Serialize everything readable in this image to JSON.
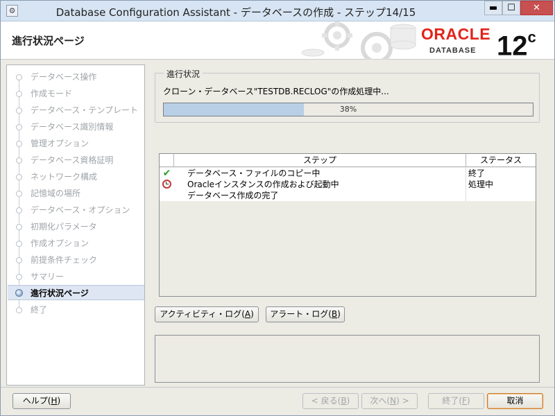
{
  "window": {
    "title": "Database Configuration Assistant - データベースの作成 - ステップ14/15",
    "minimize": "▬",
    "maximize": "☐",
    "close": "✕"
  },
  "header": {
    "page_title": "進行状況ページ",
    "brand": "ORACLE",
    "brand_sub": "DATABASE",
    "version": "12",
    "version_sup": "c"
  },
  "nav": {
    "items": [
      {
        "label": "データベース操作",
        "state": "inactive"
      },
      {
        "label": "作成モード",
        "state": "inactive"
      },
      {
        "label": "データベース・テンプレート",
        "state": "inactive"
      },
      {
        "label": "データベース識別情報",
        "state": "inactive"
      },
      {
        "label": "管理オプション",
        "state": "inactive"
      },
      {
        "label": "データベース資格証明",
        "state": "inactive"
      },
      {
        "label": "ネットワーク構成",
        "state": "inactive"
      },
      {
        "label": "記憶域の場所",
        "state": "inactive"
      },
      {
        "label": "データベース・オプション",
        "state": "inactive"
      },
      {
        "label": "初期化パラメータ",
        "state": "inactive"
      },
      {
        "label": "作成オプション",
        "state": "inactive"
      },
      {
        "label": "前提条件チェック",
        "state": "inactive"
      },
      {
        "label": "サマリー",
        "state": "inactive"
      },
      {
        "label": "進行状況ページ",
        "state": "active"
      },
      {
        "label": "終了",
        "state": "inactive"
      }
    ]
  },
  "progress": {
    "legend": "進行状況",
    "message": "クローン・データベース\"TESTDB.RECLOG\"の作成処理中...",
    "percent": 38,
    "percent_label": "38%"
  },
  "table": {
    "columns": {
      "step": "ステップ",
      "status": "ステータス"
    },
    "rows": [
      {
        "icon": "check-icon",
        "step": "データベース・ファイルのコピー中",
        "status": "終了"
      },
      {
        "icon": "clock-icon",
        "step": "Oracleインスタンスの作成および起動中",
        "status": "処理中"
      },
      {
        "icon": "",
        "step": "データベース作成の完了",
        "status": ""
      }
    ]
  },
  "log_buttons": {
    "activity_log": "アクティビティ・ログ",
    "activity_log_key": "A",
    "alert_log": "アラート・ログ",
    "alert_log_key": "B"
  },
  "footer": {
    "help": "ヘルプ",
    "help_key": "H",
    "back": "< 戻る",
    "back_key": "B",
    "next": "次へ",
    "next_key": "N",
    "next_suffix": ">",
    "finish": "終了",
    "finish_key": "F",
    "cancel": "取消"
  },
  "colors": {
    "progress_fill": "#b8cfe6",
    "oracle_red": "#e2231a",
    "check_green": "#2e9d2e",
    "clock_red": "#c03a3a"
  }
}
